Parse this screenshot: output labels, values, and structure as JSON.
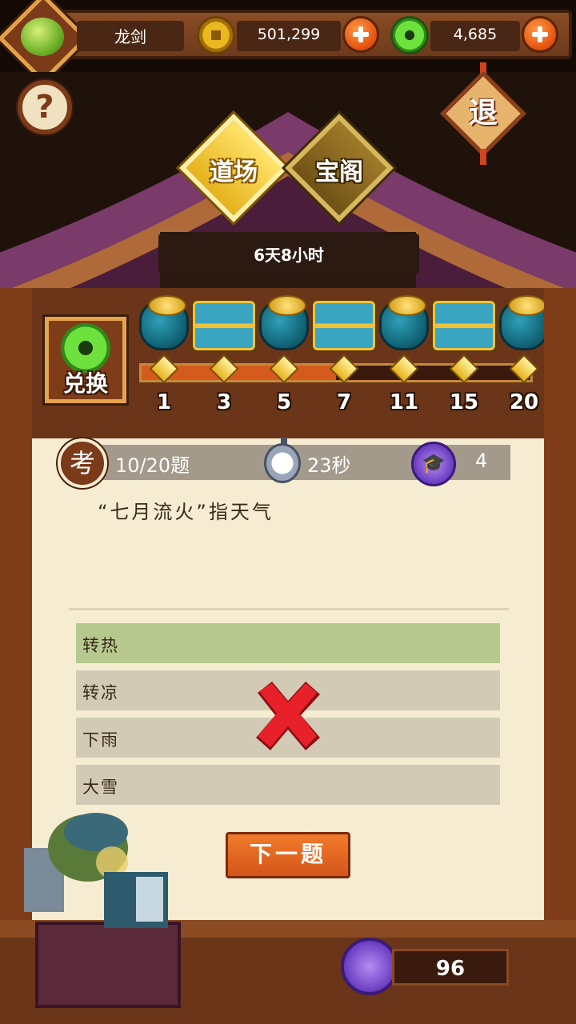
{
  "topbar": {
    "player_name": "龙剑",
    "gold": "501,299",
    "jade": "4,685"
  },
  "nav": {
    "tabs": [
      {
        "label": "道场",
        "active": true
      },
      {
        "label": "宝阁",
        "active": false
      }
    ],
    "exit_label": "退",
    "help_label": "?"
  },
  "event": {
    "time_left": "6天8小时"
  },
  "rewards": {
    "exchange_label": "兑换",
    "milestones": [
      "1",
      "3",
      "5",
      "7",
      "11",
      "15",
      "20"
    ],
    "icons": [
      "coin-bag-icon",
      "chest-icon",
      "coin-bag-icon",
      "chest-icon",
      "coin-bag-icon",
      "chest-icon",
      "coin-bag-icon"
    ],
    "progress_fraction": 0.5
  },
  "quiz": {
    "exam_badge": "考",
    "progress": "10/20题",
    "timer": "23秒",
    "points": "4",
    "question": "“七月流火”指天气",
    "options": [
      {
        "text": "转热",
        "state": "correct"
      },
      {
        "text": "转凉",
        "state": "wrong"
      },
      {
        "text": "下雨",
        "state": "normal"
      },
      {
        "text": "大雪",
        "state": "normal"
      }
    ],
    "next_label": "下一题"
  },
  "footer": {
    "total_points": "96"
  },
  "colors": {
    "correct_option": "#b6c88e",
    "option": "#d2cab4",
    "wrong_mark": "#e8202a",
    "next_button": "#e8691f"
  }
}
